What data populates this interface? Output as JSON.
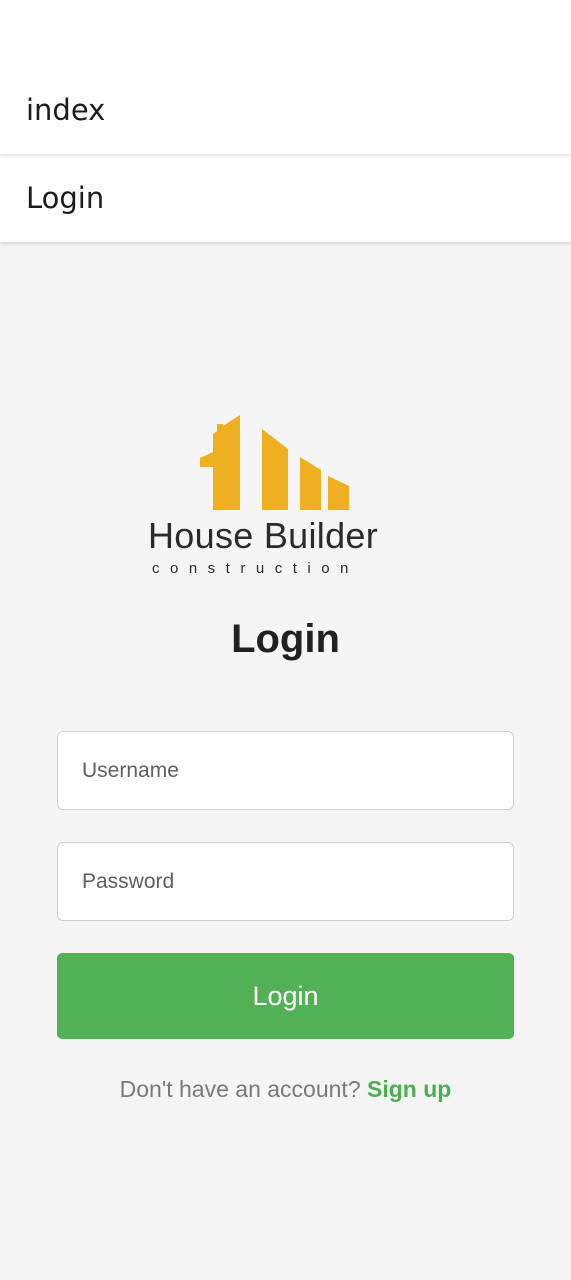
{
  "header": {
    "index_title": "index",
    "login_title": "Login"
  },
  "logo": {
    "title": "House Builder",
    "subtitle": "construction",
    "brand_color": "#EEB021",
    "icon": "house-buildings-icon"
  },
  "page_title": "Login",
  "form": {
    "username_placeholder": "Username",
    "password_placeholder": "Password",
    "login_button_label": "Login"
  },
  "signup": {
    "prompt": "Don't have an account?",
    "link_label": "Sign up",
    "link_color": "#4CAF50"
  },
  "colors": {
    "button": "#52B155",
    "background": "#F5F5F5"
  }
}
